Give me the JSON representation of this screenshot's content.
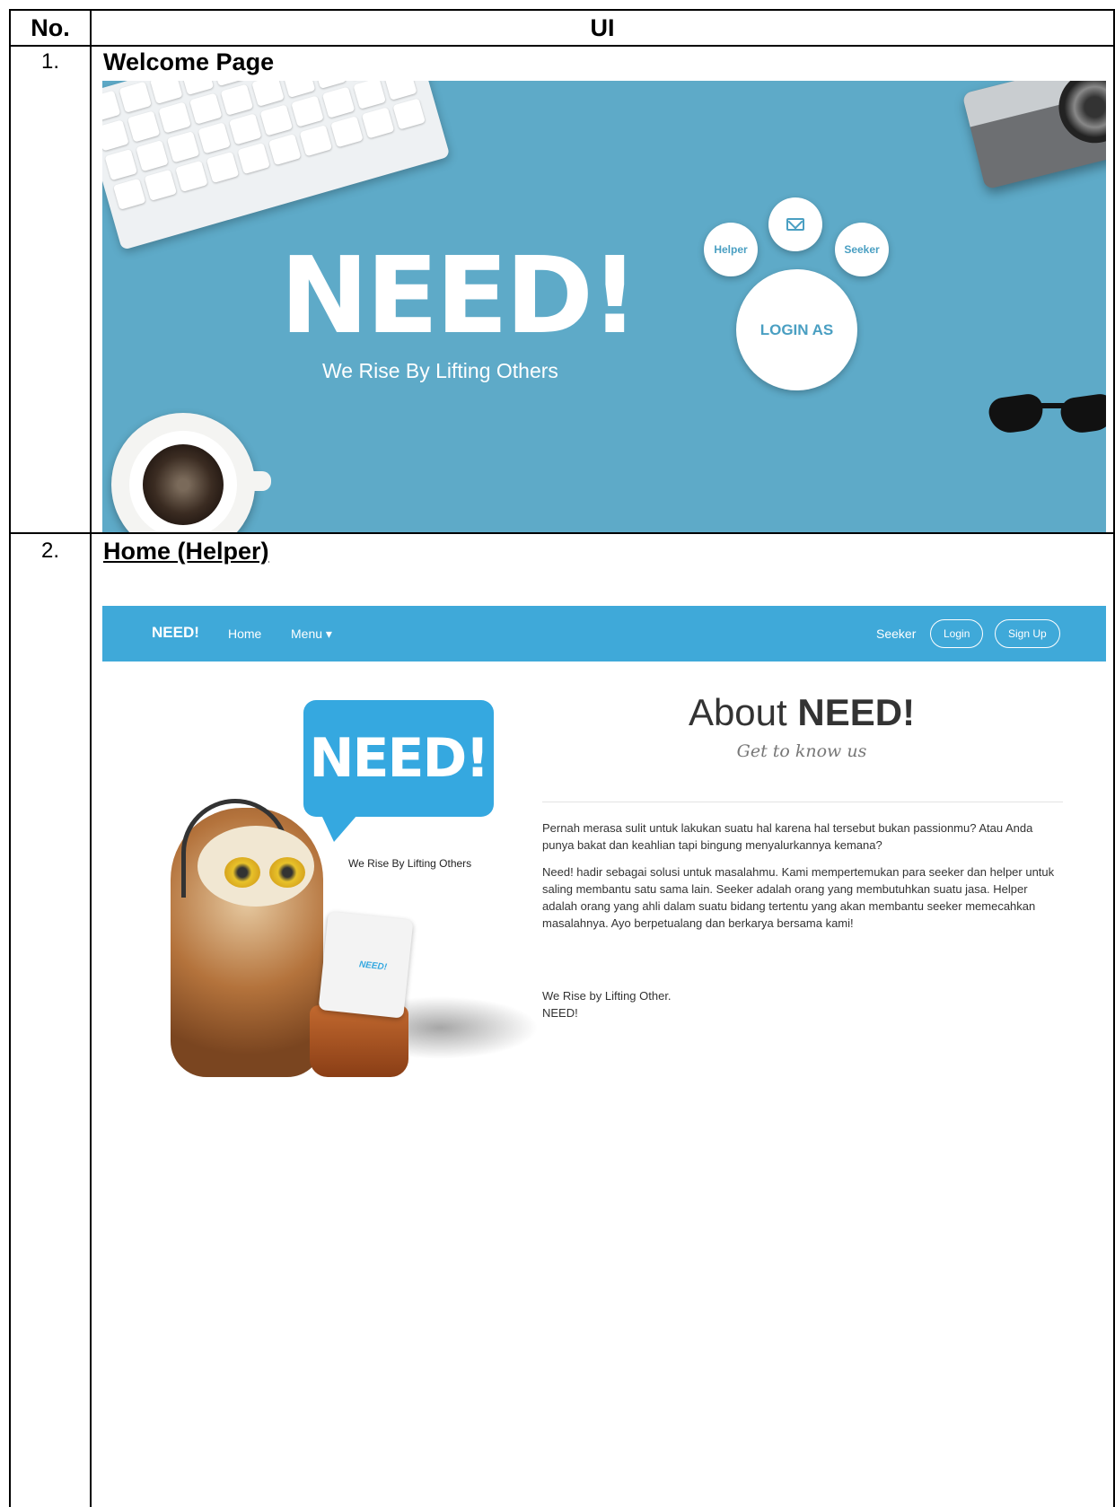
{
  "table": {
    "header_no": "No.",
    "header_ui": "UI"
  },
  "rows": [
    {
      "number": "1.",
      "title": "Welcome Page"
    },
    {
      "number": "2.",
      "title": "Home (Helper)"
    }
  ],
  "welcome": {
    "logo_text": "NEED!",
    "tagline": "We Rise By Lifting Others",
    "login_as_label": "LOGIN AS",
    "helper_label": "Helper",
    "seeker_label": "Seeker",
    "mail_icon": "mail-icon",
    "background_color": "#5eaac8"
  },
  "home": {
    "navbar": {
      "brand": "NEED!",
      "home": "Home",
      "menu": "Menu ▾",
      "seeker": "Seeker",
      "login": "Login",
      "signup": "Sign Up",
      "color": "#3fa9d9"
    },
    "hero": {
      "bubble_text": "NEED!",
      "tagline": "We Rise By Lifting Others",
      "laptop_logo": "NEED!"
    },
    "about": {
      "title_prefix": "About ",
      "title_bold": "NEED!",
      "subtitle": "Get to know us",
      "paragraph_1": "Pernah merasa sulit untuk lakukan suatu hal karena hal tersebut bukan passionmu? Atau Anda punya bakat dan keahlian tapi bingung menyalurkannya kemana?",
      "paragraph_2": "Need! hadir sebagai solusi untuk masalahmu. Kami mempertemukan para seeker dan helper untuk saling membantu satu sama lain. Seeker adalah orang yang membutuhkan suatu jasa. Helper adalah orang yang ahli dalam suatu bidang tertentu yang akan membantu seeker memecahkan masalahnya. Ayo berpetualang dan berkarya bersama kami!",
      "closing_1": "We Rise by Lifting Other.",
      "closing_2": "NEED!"
    }
  }
}
